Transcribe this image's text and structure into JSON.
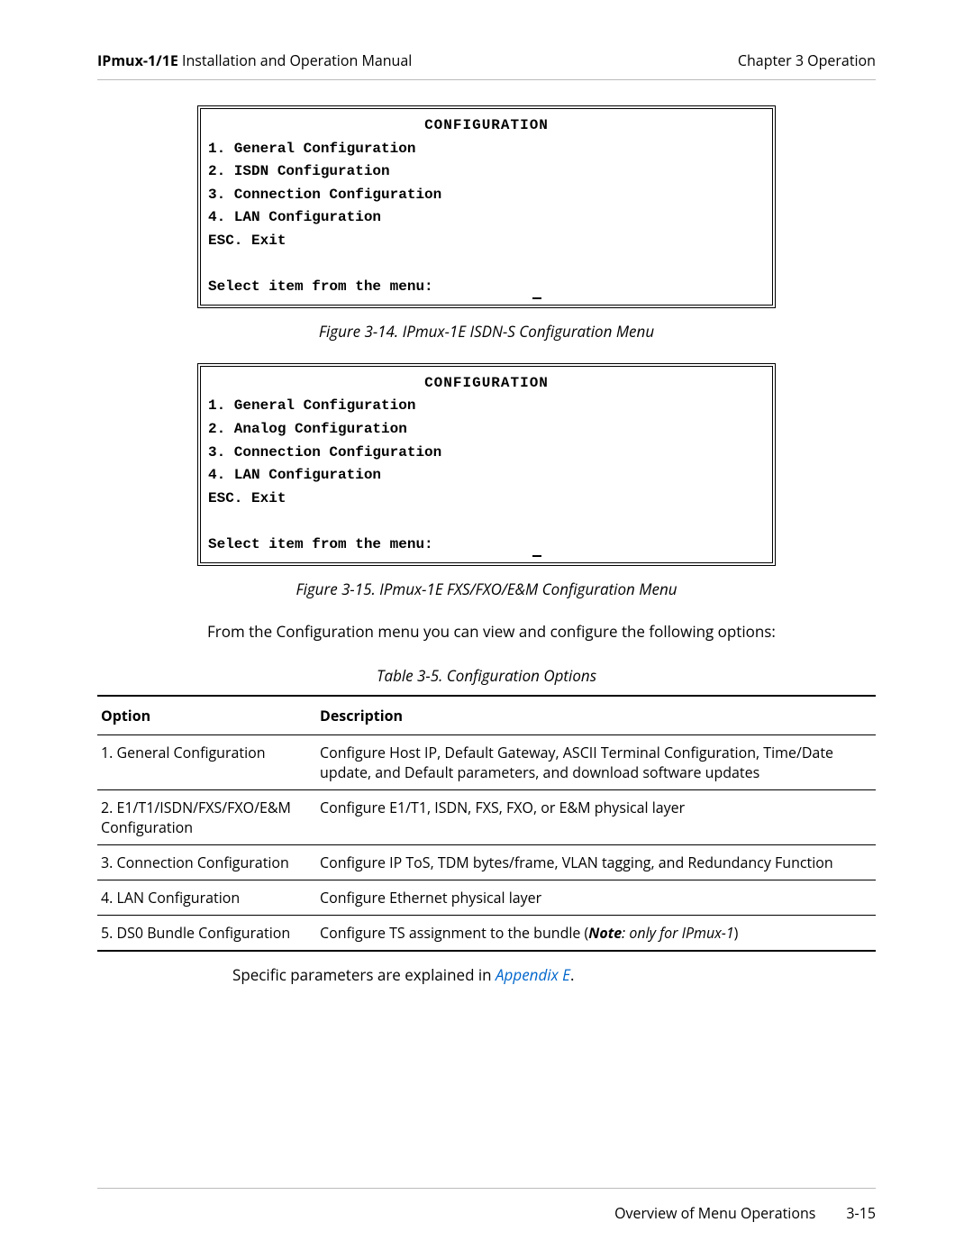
{
  "header": {
    "left_bold": "IPmux-1/1E",
    "left_rest": " Installation and Operation Manual",
    "right": "Chapter 3  Operation"
  },
  "term1": {
    "title": "CONFIGURATION",
    "lines": [
      "1. General Configuration",
      "2. ISDN Configuration",
      "3. Connection Configuration",
      "4. LAN Configuration",
      "ESC. Exit",
      " ",
      "Select item from the menu:"
    ]
  },
  "fig1_caption": "Figure 3-14.  IPmux-1E ISDN-S Configuration Menu",
  "term2": {
    "title": "CONFIGURATION",
    "lines": [
      "1. General Configuration",
      "2. Analog Configuration",
      "3. Connection Configuration",
      "4. LAN Configuration",
      "ESC. Exit",
      " ",
      "Select item from the menu:"
    ]
  },
  "fig2_caption": "Figure 3-15.  IPmux-1E FXS/FXO/E&M Configuration Menu",
  "body1": "From the Configuration menu you can view and configure the following options:",
  "table_caption": "Table 3-5.  Configuration Options",
  "table": {
    "head_option": "Option",
    "head_desc": "Description",
    "rows": [
      {
        "opt": "1. General Configuration",
        "desc": "Configure Host IP, Default Gateway, ASCII Terminal Configuration, Time/Date update, and Default parameters, and download software updates"
      },
      {
        "opt": "2. E1/T1/ISDN/FXS/FXO/E&M Configuration",
        "desc": "Configure E1/T1, ISDN, FXS, FXO, or E&M physical layer"
      },
      {
        "opt": "3. Connection Configuration",
        "desc": "Configure IP ToS, TDM bytes/frame,  VLAN tagging, and Redundancy Function"
      },
      {
        "opt": "4. LAN Configuration",
        "desc": "Configure Ethernet physical layer"
      },
      {
        "opt": "5. DS0 Bundle Configuration",
        "desc_pre": "Configure TS assignment to the bundle (",
        "note_label": "Note",
        "note_rest": ": only for IPmux-1",
        "desc_post": ")"
      }
    ]
  },
  "post_table_pre": "Specific parameters are explained in ",
  "post_table_link": "Appendix E",
  "post_table_post": ".",
  "footer": {
    "label": "Overview of Menu Operations",
    "page": "3-15"
  }
}
